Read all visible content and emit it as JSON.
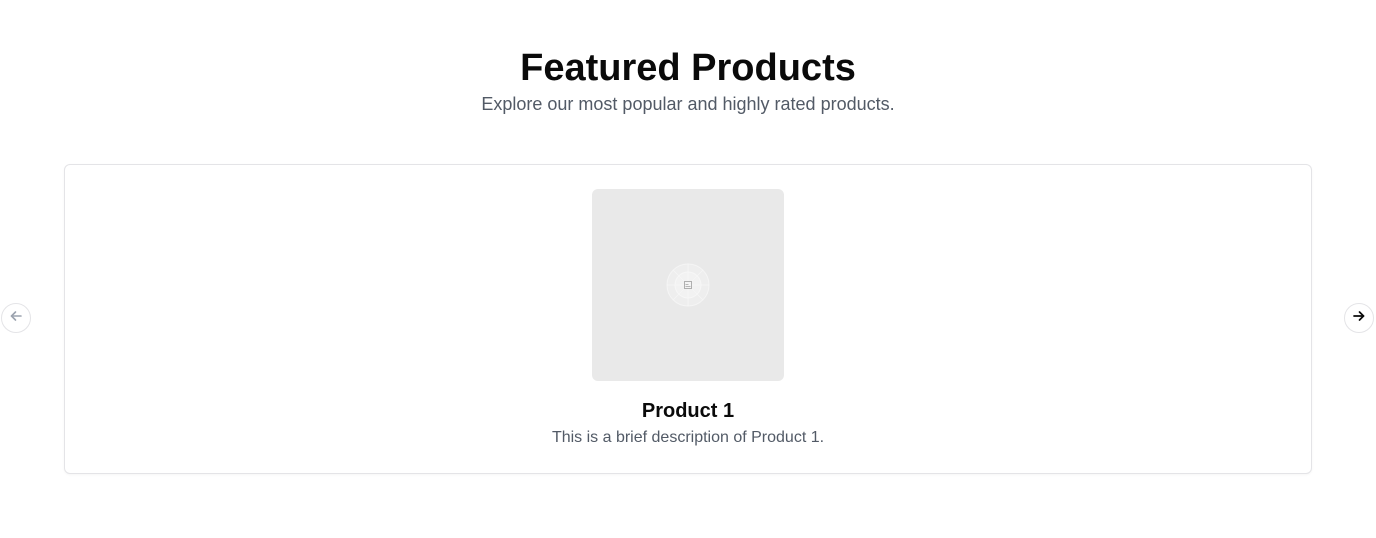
{
  "section": {
    "title": "Featured Products",
    "subtitle": "Explore our most popular and highly rated products."
  },
  "carousel": {
    "items": [
      {
        "name": "Product 1",
        "description": "This is a brief description of Product 1.",
        "image_icon": "image-placeholder-icon"
      }
    ],
    "prev_icon": "arrow-left-icon",
    "next_icon": "arrow-right-icon",
    "prev_enabled": false,
    "next_enabled": true
  },
  "colors": {
    "title": "#0a0a0a",
    "muted_text": "#525a66",
    "image_bg": "#e9e9e9",
    "border": "#e4e4e7",
    "disabled_arrow": "#9ca3af",
    "active_arrow": "#0a0a0a"
  }
}
